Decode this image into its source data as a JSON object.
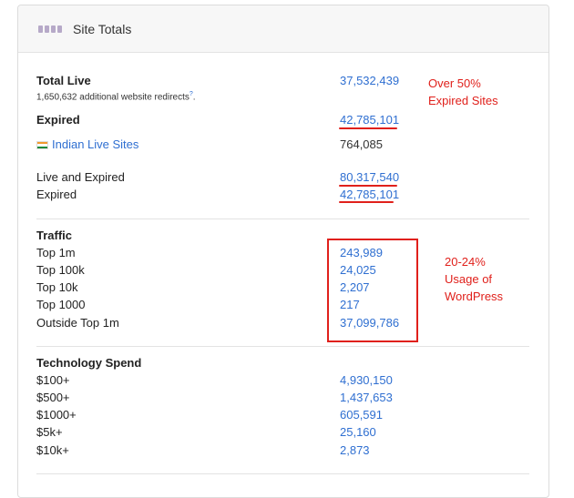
{
  "header": {
    "title": "Site Totals",
    "icon": "site-stack-icon"
  },
  "totals": {
    "total_live_label": "Total Live",
    "total_live_value": "37,532,439",
    "redirects_note": "1,650,632 additional website redirects",
    "redirects_superscript": "?",
    "expired_label": "Expired",
    "expired_value": "42,785,101",
    "indian_label": "Indian Live Sites",
    "indian_value": "764,085",
    "live_expired_label": "Live and Expired",
    "live_expired_value": "80,317,540",
    "expired2_label": "Expired",
    "expired2_value": "42,785,101"
  },
  "traffic": {
    "heading": "Traffic",
    "rows": [
      {
        "label": "Top 1m",
        "value": "243,989"
      },
      {
        "label": "Top 100k",
        "value": "24,025"
      },
      {
        "label": "Top 10k",
        "value": "2,207"
      },
      {
        "label": "Top 1000",
        "value": "217"
      },
      {
        "label": "Outside Top 1m",
        "value": "37,099,786"
      }
    ]
  },
  "spend": {
    "heading": "Technology Spend",
    "rows": [
      {
        "label": "$100+",
        "value": "4,930,150"
      },
      {
        "label": "$500+",
        "value": "1,437,653"
      },
      {
        "label": "$1000+",
        "value": "605,591"
      },
      {
        "label": "$5k+",
        "value": "25,160"
      },
      {
        "label": "$10k+",
        "value": "2,873"
      }
    ]
  },
  "annotations": {
    "expired_note_line1": "Over 50%",
    "expired_note_line2": "Expired Sites",
    "wp_note_line1": "20-24%",
    "wp_note_line2": "Usage of",
    "wp_note_line3": "WordPress",
    "color": "#e0201b"
  },
  "colors": {
    "link": "#2f6fd1",
    "flag_saffron": "#f29a2e",
    "flag_green": "#1e8a3c"
  }
}
